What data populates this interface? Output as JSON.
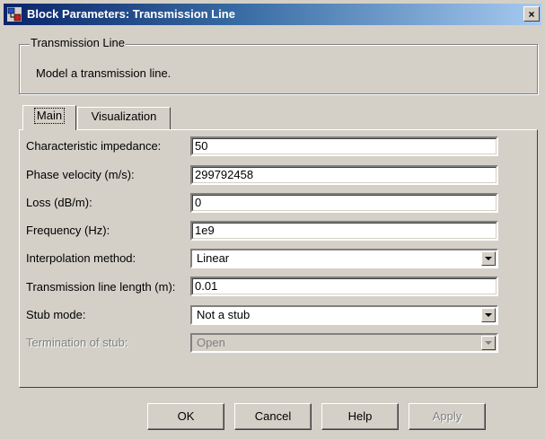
{
  "window": {
    "title": "Block Parameters: Transmission Line",
    "close_glyph": "×"
  },
  "description": {
    "group_title": "Transmission Line",
    "text": "Model a transmission line."
  },
  "tabs": [
    {
      "label": "Main",
      "active": true
    },
    {
      "label": "Visualization",
      "active": false
    }
  ],
  "parameters": {
    "characteristic_impedance": {
      "label": "Characteristic impedance:",
      "value": "50"
    },
    "phase_velocity": {
      "label": "Phase velocity (m/s):",
      "value": "299792458"
    },
    "loss": {
      "label": "Loss (dB/m):",
      "value": "0"
    },
    "frequency": {
      "label": "Frequency (Hz):",
      "value": "1e9"
    },
    "interpolation_method": {
      "label": "Interpolation method:",
      "value": "Linear"
    },
    "line_length": {
      "label": "Transmission line length (m):",
      "value": "0.01"
    },
    "stub_mode": {
      "label": "Stub mode:",
      "value": "Not a stub"
    },
    "termination_of_stub": {
      "label": "Termination of stub:",
      "value": "Open",
      "disabled": true
    }
  },
  "buttons": {
    "ok": "OK",
    "cancel": "Cancel",
    "help": "Help",
    "apply": "Apply"
  },
  "colors": {
    "dialog_face": "#d4d0c8",
    "titlebar_start": "#0a246a",
    "titlebar_end": "#a6caf0",
    "disabled_text": "#808080"
  }
}
